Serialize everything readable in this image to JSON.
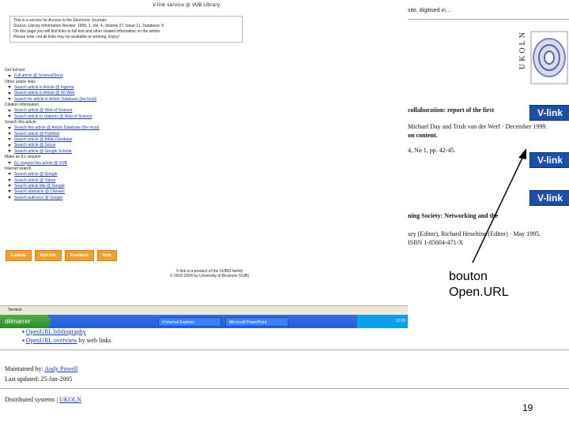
{
  "left_browser": {
    "header": "V-link service @ VUB Library",
    "info_lines": [
      "This is a service for Access to the Electronic Journals",
      "Source: Library Information Review: 1999, 1, Vol. 4, Volume 27, Issue 11, Database: 6",
      "On this page you will find links to full text and other related information on the article",
      "Please note: not all links may be available or working, Enjoy!"
    ],
    "menu": [
      {
        "section": "Get full text",
        "items": [
          "Full article @ ScienceDirect"
        ]
      },
      {
        "section": "Other article links",
        "items": [
          "Search article in Article @ Ingenta",
          "Search article in Article @ ISI Web",
          "Search for article in Article Database (the local)"
        ]
      },
      {
        "section": "Citation information",
        "items": [
          "Search article @ Web of Science",
          "Search article to citations @ Web of Science"
        ]
      },
      {
        "section": "Search this article",
        "items": [
          "Search this article @ Article Database (the local)",
          "Search article @ PubMed",
          "Search article @ Biblio Database",
          "Search article @ Scirus",
          "Search article @ Google Scholar"
        ]
      },
      {
        "section": "Make an ILL request",
        "items": [
          "ILL request this article @ VUB"
        ]
      },
      {
        "section": "Internet search",
        "items": [
          "Search article @ Google",
          "Search article @ Yahoo",
          "Search article title @ Google",
          "Search abstracts @ Citeseer",
          "Search author(s) @ Google"
        ]
      }
    ],
    "buttons": [
      "LookUp",
      "MyV-link",
      "Feedback",
      "Help"
    ],
    "product_line1": "V-link is a product of the VUBIS family",
    "product_line2": "© 2002-2004 by University of Brussels (VUB)",
    "status_text": "Terminé",
    "taskbar_start": "démarrer",
    "taskbar_apps": [
      "4 Internet Explorer",
      "Microsoft PowerPoint"
    ],
    "tray_text": "12:00"
  },
  "right_panel": {
    "top_text": "site, digitised in…",
    "logo_letters": "UKOLN",
    "lines": [
      "collaboration: report of the first",
      "Michael Day and Trish van der Werf · December 1999.",
      "on content.",
      "4, No 1, pp. 42-45.",
      "ning Society: Networking and the",
      "sey (Editor), Richard Heseltine (Editor) · May 1995.",
      "ISBN 1-85604-471-X"
    ],
    "vlink_label": "V-link",
    "annotation_line1": "bouton",
    "annotation_line2": "Open.URL"
  },
  "bottom": {
    "link1": "OpenURL bibliography",
    "link2": "OpenURL overview",
    "link2_suffix": " by web links",
    "maintained_label": "Maintained by: ",
    "maintained_name": "Andy Powell",
    "last_updated": "Last updated: 25-Jan-2005",
    "footer_label": "Distributed systems | ",
    "footer_link": "UKOLN"
  },
  "page_number": "19",
  "colors": {
    "accent_orange": "#f1a02e",
    "vlink_blue": "#1d4fa8",
    "taskbar_blue": "#245edb",
    "start_green": "#2f8a2c"
  }
}
